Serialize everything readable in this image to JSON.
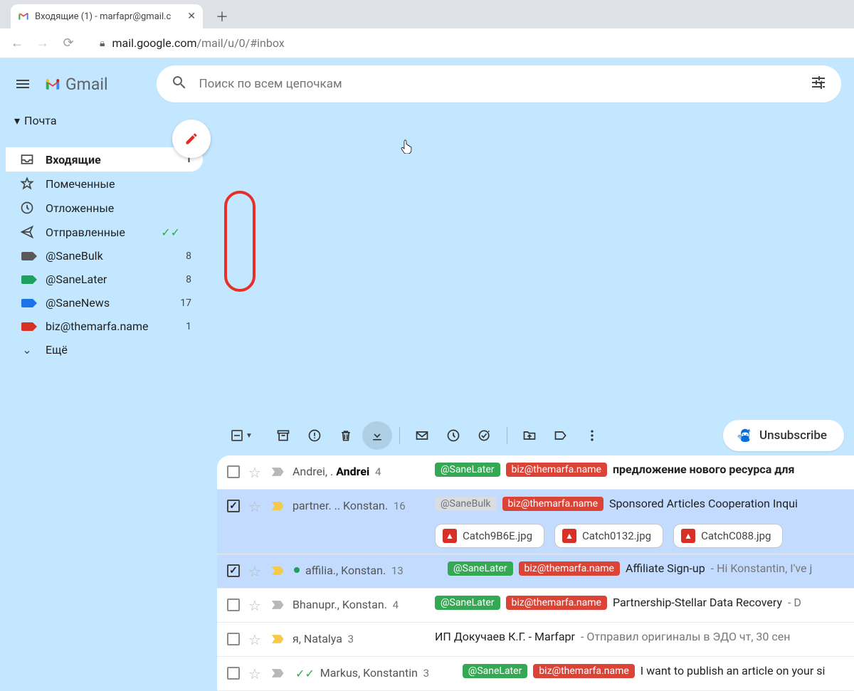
{
  "browser": {
    "tab_title": "Входящие (1) - marfapr@gmail.c",
    "url_host": "mail.google.com",
    "url_path": "/mail/u/0/#inbox"
  },
  "header": {
    "product": "Gmail",
    "search_placeholder": "Поиск по всем цепочкам"
  },
  "sidebar": {
    "section": "Почта",
    "items": [
      {
        "label": "Входящие",
        "count": "1",
        "icon": "inbox",
        "active": true
      },
      {
        "label": "Помеченные",
        "count": "",
        "icon": "star",
        "active": false
      },
      {
        "label": "Отложенные",
        "count": "",
        "icon": "clock",
        "active": false
      },
      {
        "label": "Отправленные",
        "count": "",
        "icon": "send",
        "active": false,
        "green_checks": true
      },
      {
        "label": "@SaneBulk",
        "count": "8",
        "icon": "tag",
        "tag_color": "#595959",
        "active": false
      },
      {
        "label": "@SaneLater",
        "count": "8",
        "icon": "tag",
        "tag_color": "#1ba261",
        "active": false
      },
      {
        "label": "@SaneNews",
        "count": "17",
        "icon": "tag",
        "tag_color": "#1a73e8",
        "active": false
      },
      {
        "label": "biz@themarfa.name",
        "count": "1",
        "icon": "tag",
        "tag_color": "#d93025",
        "active": false
      }
    ],
    "more": "Ещё"
  },
  "toolbar": {
    "unsubscribe": "Unsubscribe"
  },
  "emails": [
    {
      "checked": false,
      "selected": false,
      "imp_color": "#b7b7b7",
      "sender_html": "Andrei, . <b>Andrei</b>",
      "thread": "4",
      "labels": [
        {
          "cls": "lbl-green",
          "text": "@SaneLater"
        },
        {
          "cls": "lbl-red",
          "text": "biz@themarfa.name"
        }
      ],
      "subject": "<b>предложение нового ресурса для</b>",
      "snippet": ""
    },
    {
      "checked": true,
      "selected": true,
      "imp_color": "#f7c948",
      "sender_html": "partner. .. Konstan.",
      "thread": "16",
      "labels": [
        {
          "cls": "lbl-grey",
          "text": "@SaneBulk"
        },
        {
          "cls": "lbl-red",
          "text": "biz@themarfa.name"
        }
      ],
      "subject": "Sponsored Articles Cooperation Inqui",
      "snippet": "",
      "attachments": [
        "Catch9B6E.jpg",
        "Catch0132.jpg",
        "CatchC088.jpg"
      ]
    },
    {
      "checked": true,
      "selected": true,
      "imp_color": "#f7c948",
      "green_dot": true,
      "sender_html": "affilia., Konstan.",
      "thread": "13",
      "labels": [
        {
          "cls": "lbl-green",
          "text": "@SaneLater"
        },
        {
          "cls": "lbl-red",
          "text": "biz@themarfa.name"
        }
      ],
      "subject": "Affiliate Sign-up",
      "snippet": " - Hi Konstantin, I've j"
    },
    {
      "checked": false,
      "selected": false,
      "imp_color": "#b7b7b7",
      "sender_html": "Bhanupr., Konstan.",
      "thread": "4",
      "labels": [
        {
          "cls": "lbl-green",
          "text": "@SaneLater"
        },
        {
          "cls": "lbl-red",
          "text": "biz@themarfa.name"
        }
      ],
      "subject": "Partnership-Stellar Data Recovery",
      "snippet": " - D"
    },
    {
      "checked": false,
      "selected": false,
      "imp_color": "#f7c948",
      "sender_html": "я, Natalya",
      "thread": "3",
      "labels": [],
      "subject": "ИП Докучаев К.Г. - Marfapr",
      "snippet": " - Отправил оригиналы в ЭДО чт, 30 сен"
    },
    {
      "checked": false,
      "selected": false,
      "imp_color": "#b7b7b7",
      "green_checks": true,
      "sender_html": "Markus, Konstantin",
      "thread": "3",
      "labels": [
        {
          "cls": "lbl-green",
          "text": "@SaneLater"
        },
        {
          "cls": "lbl-red",
          "text": "biz@themarfa.name"
        }
      ],
      "subject": "I want to publish an article on your si",
      "snippet": ""
    }
  ]
}
